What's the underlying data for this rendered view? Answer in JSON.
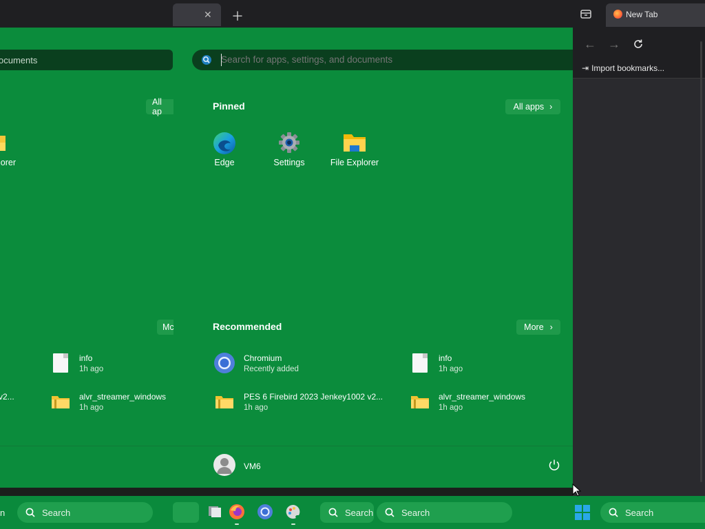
{
  "browser": {
    "active_tab_label": "New Tab",
    "import_bookmarks": "Import bookmarks..."
  },
  "start_menu": {
    "search_placeholder": "Search for apps, settings, and documents",
    "left_search_fragment": "ocuments",
    "pinned": {
      "title": "Pinned",
      "all_apps_label": "All apps",
      "left_all_apps_fragment": "All ap",
      "apps": [
        {
          "label": "Edge",
          "icon": "edge-icon"
        },
        {
          "label": "Settings",
          "icon": "gear-icon"
        },
        {
          "label": "File Explorer",
          "icon": "folder-icon"
        }
      ],
      "left_app_fragment": "lorer"
    },
    "recommended": {
      "title": "Recommended",
      "more_label": "More",
      "left_more_fragment": "Mc",
      "items": [
        {
          "name": "Chromium",
          "sub": "Recently added",
          "icon": "chromium-icon"
        },
        {
          "name": "info",
          "sub": "1h ago",
          "icon": "document-icon"
        },
        {
          "name": "PES 6 Firebird 2023 Jenkey1002 v2...",
          "sub": "1h ago",
          "icon": "zip-folder-icon"
        },
        {
          "name": "alvr_streamer_windows",
          "sub": "1h ago",
          "icon": "zip-folder-icon"
        }
      ],
      "left_items": [
        {
          "name": "info",
          "sub": "1h ago"
        },
        {
          "name": "alvr_streamer_windows",
          "sub": "1h ago"
        }
      ],
      "left_fragment": "v2..."
    },
    "user": {
      "name": "VM6"
    }
  },
  "taskbar": {
    "search_labels": [
      "Search",
      "Search",
      "Search",
      "Search"
    ],
    "left_fragment": "n"
  },
  "colors": {
    "start_green": "#0b8c3c",
    "taskbar_green": "#0a8a3c",
    "search_dark": "#0a3f1e",
    "browser_dark": "#1f1f22"
  }
}
